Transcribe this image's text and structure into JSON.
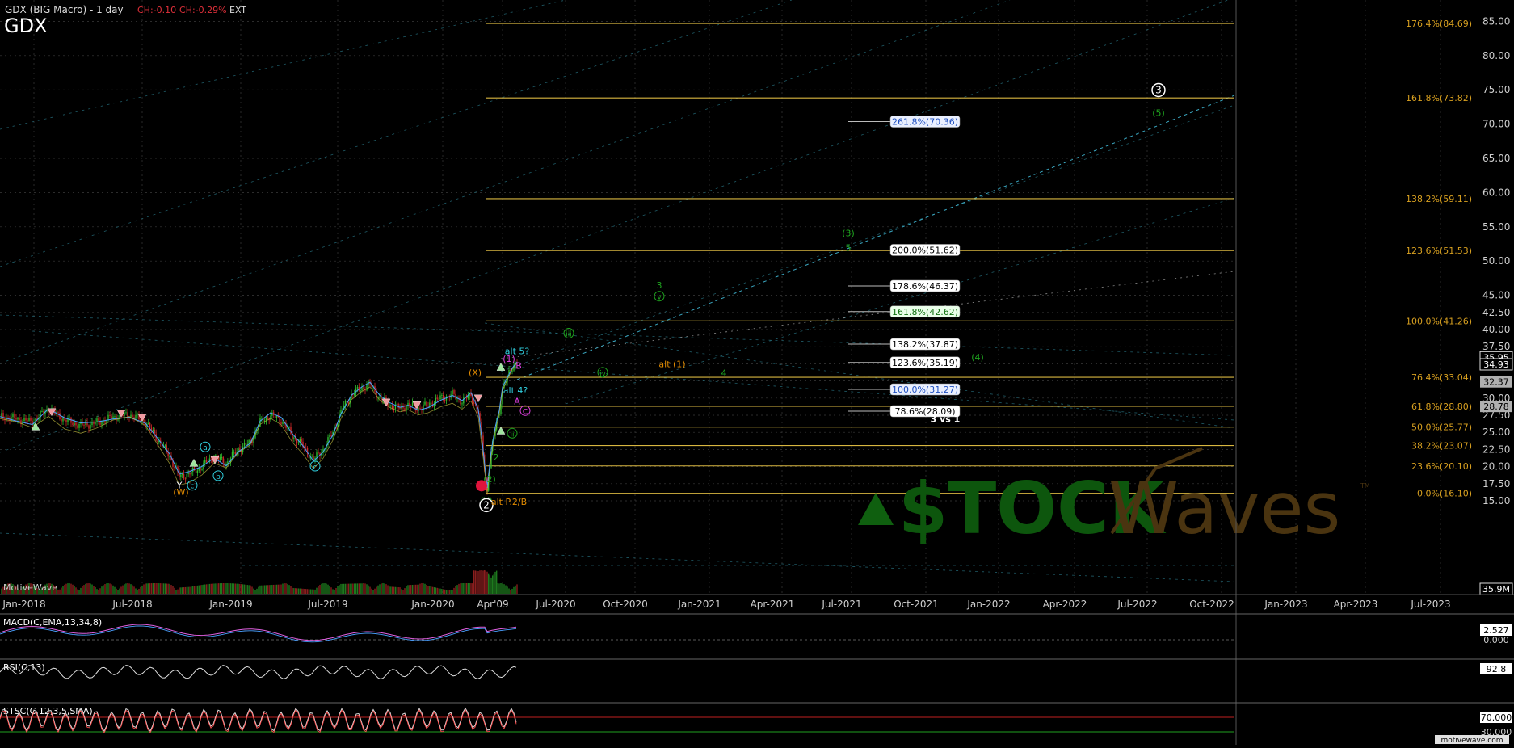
{
  "header": {
    "symbol_line": "GDX (BIG Macro) - 1 day",
    "ch_abs": "CH:-0.10",
    "ch_pct": "CH:-0.29%",
    "ext": "EXT",
    "ticker": "GDX"
  },
  "watermark": {
    "brand": "MotiveWave",
    "logo_left": "$TOCK",
    "logo_right": "Waves",
    "logo_tm": "TM",
    "footer_url": "motivewave.com"
  },
  "colors": {
    "background": "#000000",
    "fib_line": "#d8b640",
    "fib_label": "#d8a020",
    "price_up": "#2fbf2f",
    "price_down": "#d02a2a",
    "grid": "#3a3a3a",
    "wave_green": "#1fa51f",
    "wave_orange": "#e08a00",
    "wave_magenta": "#e040e0",
    "wave_cyan": "#30d0e0"
  },
  "chart_data": [
    {
      "type": "line",
      "name": "price",
      "y_scale": "linear",
      "ylim": [
        12.5,
        90
      ],
      "y_ticks": [
        15,
        17.5,
        20,
        22.5,
        25,
        27.5,
        30,
        32.5,
        35,
        37.5,
        40,
        42.5,
        45,
        50,
        55,
        60,
        65,
        70,
        75,
        80,
        85
      ],
      "x_labels": [
        "Jan-2018",
        "Jul-2018",
        "Jan-2019",
        "Jul-2019",
        "Jan-2020",
        "Apr'09",
        "Jul-2020",
        "Oct-2020",
        "Jan-2021",
        "Apr-2021",
        "Jul-2021",
        "Oct-2021",
        "Jan-2022",
        "Apr-2022",
        "Jul-2022",
        "Oct-2022",
        "Jan-2023",
        "Apr-2023",
        "Jul-2023"
      ],
      "price_tags": [
        {
          "text": "35.95",
          "y": 35.95,
          "style": "outline"
        },
        {
          "text": "34.93",
          "y": 34.93,
          "style": "outline"
        },
        {
          "text": "32.37",
          "y": 32.37,
          "style": "gray"
        },
        {
          "text": "28.78",
          "y": 28.78,
          "style": "gray"
        }
      ],
      "volume_tag": "35.9M",
      "fib_levels_right": [
        {
          "label": "176.4%(84.69)",
          "y": 84.69
        },
        {
          "label": "161.8%(73.82)",
          "y": 73.82
        },
        {
          "label": "138.2%(59.11)",
          "y": 59.11
        },
        {
          "label": "123.6%(51.53)",
          "y": 51.53
        },
        {
          "label": "100.0%(41.26)",
          "y": 41.26
        },
        {
          "label": "76.4%(33.04)",
          "y": 33.04
        },
        {
          "label": "61.8%(28.80)",
          "y": 28.8
        },
        {
          "label": "50.0%(25.77)",
          "y": 25.77
        },
        {
          "label": "38.2%(23.07)",
          "y": 23.07
        },
        {
          "label": "23.6%(20.10)",
          "y": 20.1
        },
        {
          "label": "0.0%(16.10)",
          "y": 16.1
        }
      ],
      "fib_boxes_mid": [
        {
          "label": "261.8%(70.36)",
          "y": 70.36,
          "style": "blue"
        },
        {
          "label": "200.0%(51.62)",
          "y": 51.62,
          "style": "white"
        },
        {
          "label": "178.6%(46.37)",
          "y": 46.37,
          "style": "white"
        },
        {
          "label": "161.8%(42.62)",
          "y": 42.62,
          "style": "green"
        },
        {
          "label": "138.2%(37.87)",
          "y": 37.87,
          "style": "white"
        },
        {
          "label": "123.6%(35.19)",
          "y": 35.19,
          "style": "white"
        },
        {
          "label": "100.0%(31.27)",
          "y": 31.27,
          "style": "blue"
        },
        {
          "label": "78.6%(28.09)",
          "y": 28.09,
          "style": "white"
        }
      ],
      "wave_labels": [
        {
          "text": "3",
          "style": "circle-white"
        },
        {
          "text": "(5)",
          "color": "green"
        },
        {
          "text": "(3)",
          "color": "green"
        },
        {
          "text": "5",
          "color": "green"
        },
        {
          "text": "3",
          "color": "green"
        },
        {
          "text": "v",
          "color": "green-circle"
        },
        {
          "text": "iii",
          "color": "green-circle"
        },
        {
          "text": "(4)",
          "color": "green"
        },
        {
          "text": "alt (1)",
          "color": "orange"
        },
        {
          "text": "4",
          "color": "green"
        },
        {
          "text": "iv",
          "color": "green-circle"
        },
        {
          "text": "alt 5?",
          "color": "cyan"
        },
        {
          "text": "(1)",
          "color": "magenta"
        },
        {
          "text": "B",
          "color": "magenta"
        },
        {
          "text": "(X)",
          "color": "orange"
        },
        {
          "text": "alt 4?",
          "color": "cyan"
        },
        {
          "text": "A",
          "color": "magenta"
        },
        {
          "text": "C",
          "color": "magenta-circle"
        },
        {
          "text": "3 vs 1",
          "color": "white"
        },
        {
          "text": "ii",
          "color": "green-circle"
        },
        {
          "text": "2",
          "color": "green"
        },
        {
          "text": "(2)",
          "color": "green"
        },
        {
          "text": "(Y)",
          "color": "green"
        },
        {
          "text": "2",
          "style": "circle-white"
        },
        {
          "text": "alt P.2/B",
          "color": "orange"
        },
        {
          "text": "Y",
          "color": "white"
        },
        {
          "text": "(W)",
          "color": "orange"
        },
        {
          "text": "c",
          "color": "cyan-circle"
        },
        {
          "text": "a",
          "color": "cyan-circle"
        },
        {
          "text": "b",
          "color": "cyan-circle"
        },
        {
          "text": "c",
          "color": "cyan-circle"
        }
      ]
    },
    {
      "type": "line",
      "name": "MACD(C,EMA,13,34,8)",
      "title": "MACD(C,EMA,13,34,8)",
      "y_ticks": [
        {
          "label": "2.527",
          "y": 2.527,
          "tag": true
        },
        {
          "label": "0.000",
          "y": 0.0,
          "tag": false
        }
      ]
    },
    {
      "type": "line",
      "name": "RSI(C,13)",
      "title": "RSI(C,13)",
      "y_ticks": [
        {
          "label": "92.8",
          "y": 92.8,
          "tag": true
        }
      ]
    },
    {
      "type": "line",
      "name": "STSC(C,12,3,5,SMA)",
      "title": "STSC(C,12,3,5,SMA)",
      "y_ticks": [
        {
          "label": "70.000",
          "y": 70.0,
          "tag": true
        },
        {
          "label": "30.000",
          "y": 30.0,
          "tag": false
        }
      ]
    }
  ]
}
